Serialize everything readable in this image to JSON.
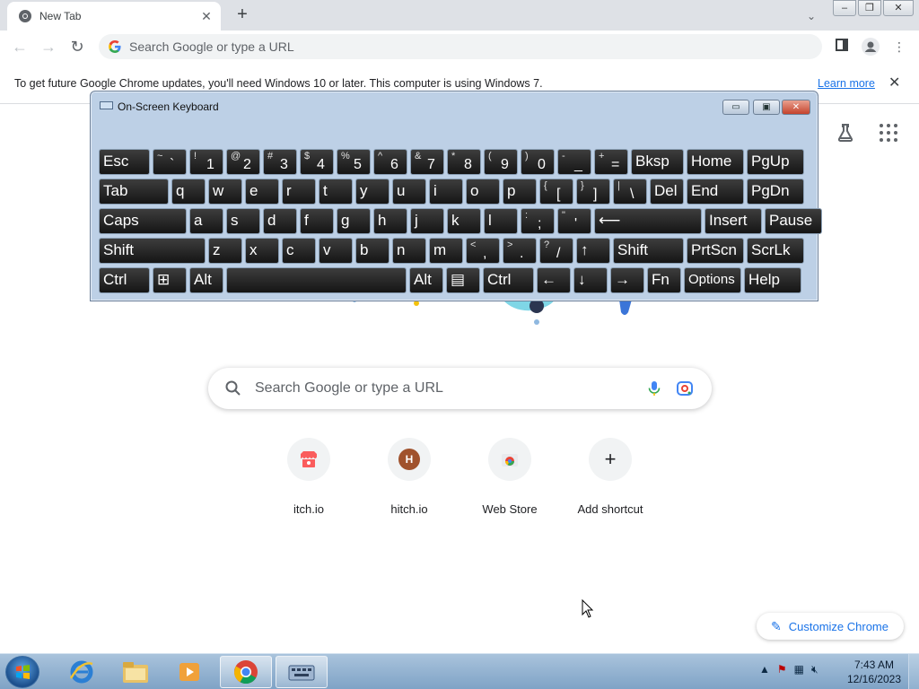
{
  "tab": {
    "title": "New Tab"
  },
  "toolbar": {
    "omnibox_placeholder": "Search Google or type a URL"
  },
  "infobar": {
    "message": "To get future Google Chrome updates, you'll need Windows 10 or later. This computer is using Windows 7.",
    "link": "Learn more"
  },
  "osk": {
    "title": "On-Screen Keyboard",
    "rows": [
      [
        {
          "main": "Esc"
        },
        {
          "shift": "~",
          "main": "`"
        },
        {
          "shift": "!",
          "main": "1"
        },
        {
          "shift": "@",
          "main": "2"
        },
        {
          "shift": "#",
          "main": "3"
        },
        {
          "shift": "$",
          "main": "4"
        },
        {
          "shift": "%",
          "main": "5"
        },
        {
          "shift": "^",
          "main": "6"
        },
        {
          "shift": "&",
          "main": "7"
        },
        {
          "shift": "*",
          "main": "8"
        },
        {
          "shift": "(",
          "main": "9"
        },
        {
          "shift": ")",
          "main": "0"
        },
        {
          "shift": "-",
          "main": "_"
        },
        {
          "shift": "+",
          "main": "="
        },
        {
          "main": "Bksp"
        },
        {
          "main": "Home"
        },
        {
          "main": "PgUp"
        }
      ],
      [
        {
          "main": "Tab"
        },
        {
          "main": "q"
        },
        {
          "main": "w"
        },
        {
          "main": "e"
        },
        {
          "main": "r"
        },
        {
          "main": "t"
        },
        {
          "main": "y"
        },
        {
          "main": "u"
        },
        {
          "main": "i"
        },
        {
          "main": "o"
        },
        {
          "main": "p"
        },
        {
          "shift": "{",
          "main": "["
        },
        {
          "shift": "}",
          "main": "]"
        },
        {
          "shift": "|",
          "main": "\\"
        },
        {
          "main": "Del"
        },
        {
          "main": "End"
        },
        {
          "main": "PgDn"
        }
      ],
      [
        {
          "main": "Caps"
        },
        {
          "main": "a"
        },
        {
          "main": "s"
        },
        {
          "main": "d"
        },
        {
          "main": "f"
        },
        {
          "main": "g"
        },
        {
          "main": "h"
        },
        {
          "main": "j"
        },
        {
          "main": "k"
        },
        {
          "main": "l"
        },
        {
          "shift": ":",
          "main": ";"
        },
        {
          "shift": "\"",
          "main": "'"
        },
        {
          "main": "⟵"
        },
        {
          "main": "Insert"
        },
        {
          "main": "Pause"
        }
      ],
      [
        {
          "main": "Shift"
        },
        {
          "main": "z"
        },
        {
          "main": "x"
        },
        {
          "main": "c"
        },
        {
          "main": "v"
        },
        {
          "main": "b"
        },
        {
          "main": "n"
        },
        {
          "main": "m"
        },
        {
          "shift": "<",
          "main": ","
        },
        {
          "shift": ">",
          "main": "."
        },
        {
          "shift": "?",
          "main": "/"
        },
        {
          "main": "↑"
        },
        {
          "main": "Shift"
        },
        {
          "main": "PrtScn"
        },
        {
          "main": "ScrLk"
        }
      ],
      [
        {
          "main": "Ctrl"
        },
        {
          "main": "⊞"
        },
        {
          "main": "Alt"
        },
        {
          "main": ""
        },
        {
          "main": "Alt"
        },
        {
          "main": "▤"
        },
        {
          "main": "Ctrl"
        },
        {
          "main": "←"
        },
        {
          "main": "↓"
        },
        {
          "main": "→"
        },
        {
          "main": "Fn"
        },
        {
          "main": "Options"
        },
        {
          "main": "Help"
        }
      ]
    ]
  },
  "ntp": {
    "search_placeholder": "Search Google or type a URL",
    "shortcuts": [
      {
        "label": "itch.io",
        "icon": "itch-icon"
      },
      {
        "label": "hitch.io",
        "icon": "letter-h-avatar",
        "letter": "H"
      },
      {
        "label": "Web Store",
        "icon": "web-store-icon"
      },
      {
        "label": "Add shortcut",
        "icon": "plus-icon"
      }
    ],
    "customize": "Customize Chrome"
  },
  "taskbar": {
    "time": "7:43 AM",
    "date": "12/16/2023"
  },
  "colors": {
    "link": "#1a73e8",
    "osk_frame": "#bdd0e6",
    "key": "#1f1f1f",
    "taskbar": "#8fb0cf"
  }
}
